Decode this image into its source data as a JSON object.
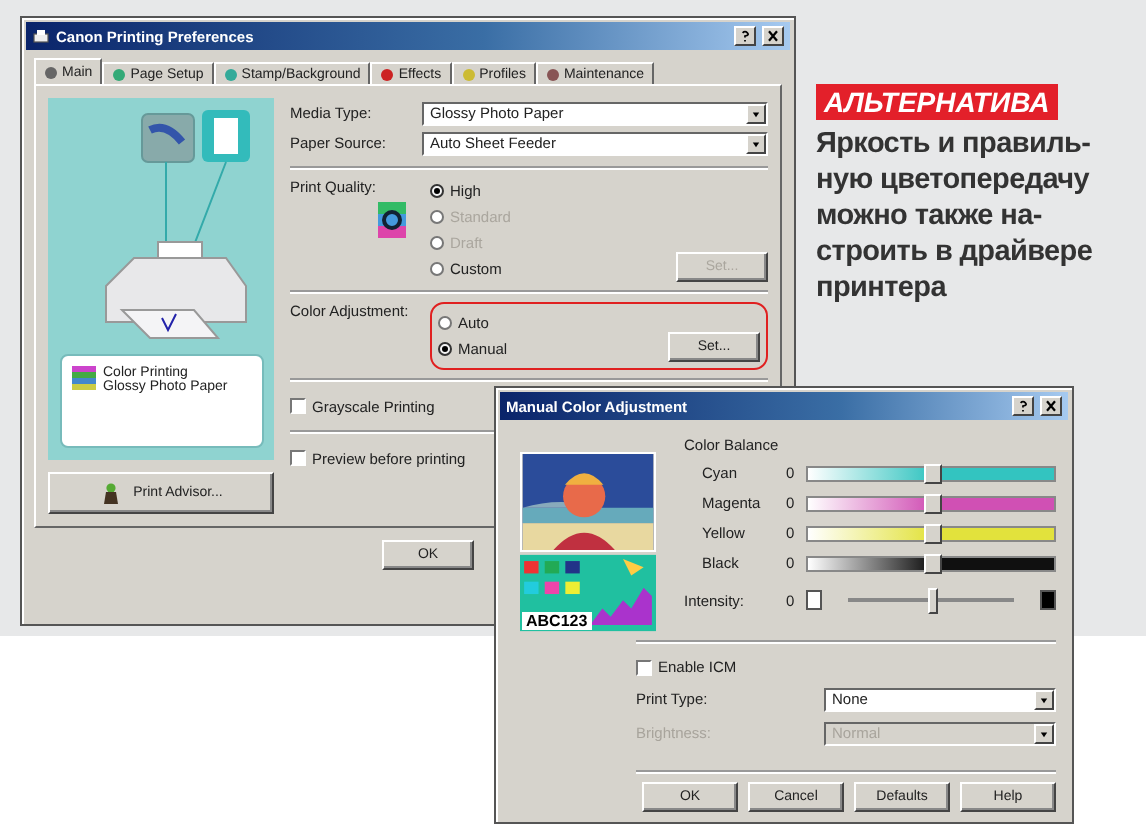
{
  "main_window": {
    "title": "Canon Printing Preferences",
    "tabs": [
      {
        "label": "Main",
        "selected": true
      },
      {
        "label": "Page Setup",
        "selected": false
      },
      {
        "label": "Stamp/Background",
        "selected": false
      },
      {
        "label": "Effects",
        "selected": false
      },
      {
        "label": "Profiles",
        "selected": false
      },
      {
        "label": "Maintenance",
        "selected": false
      }
    ],
    "preview_card": {
      "lines": [
        "Color Printing",
        "Glossy Photo Paper"
      ]
    },
    "print_advisor_button": "Print Advisor...",
    "media_type": {
      "label": "Media Type:",
      "value": "Glossy Photo Paper"
    },
    "paper_source": {
      "label": "Paper Source:",
      "value": "Auto Sheet Feeder"
    },
    "print_quality": {
      "label": "Print Quality:",
      "options": [
        {
          "label": "High",
          "selected": true,
          "disabled": false
        },
        {
          "label": "Standard",
          "selected": false,
          "disabled": true
        },
        {
          "label": "Draft",
          "selected": false,
          "disabled": true
        },
        {
          "label": "Custom",
          "selected": false,
          "disabled": false
        }
      ],
      "set_button": {
        "label": "Set...",
        "disabled": true
      }
    },
    "color_adjustment": {
      "label": "Color Adjustment:",
      "highlighted": true,
      "options": [
        {
          "label": "Auto",
          "selected": false,
          "disabled": false
        },
        {
          "label": "Manual",
          "selected": true,
          "disabled": false
        }
      ],
      "set_button": {
        "label": "Set...",
        "disabled": false
      }
    },
    "checkboxes": [
      {
        "label": "Grayscale Printing",
        "checked": false
      },
      {
        "label": "Preview before printing",
        "checked": false
      }
    ],
    "buttons": [
      "OK"
    ]
  },
  "color_dialog": {
    "title": "Manual Color Adjustment",
    "sample_text": "ABC123",
    "color_balance": {
      "label": "Color Balance",
      "channels": [
        {
          "name": "Cyan",
          "reading": "0",
          "level": 0.5,
          "color": "#33c4c0"
        },
        {
          "name": "Magenta",
          "reading": "0",
          "level": 0.5,
          "color": "#d050b4"
        },
        {
          "name": "Yellow",
          "reading": "0",
          "level": 0.5,
          "color": "#e2e23c"
        },
        {
          "name": "Black",
          "reading": "0",
          "level": 0.5,
          "color": "#101010"
        }
      ]
    },
    "intensity": {
      "label": "Intensity:",
      "reading": "0",
      "level": 0.5
    },
    "enable_icm": {
      "label": "Enable ICM",
      "checked": false
    },
    "print_type": {
      "label": "Print Type:",
      "value": "None",
      "disabled": false
    },
    "brightness": {
      "label": "Brightness:",
      "value": "Normal",
      "disabled": true
    },
    "buttons": [
      "OK",
      "Cancel",
      "Defaults",
      "Help"
    ]
  },
  "caption": {
    "tag": "АЛЬТЕРНАТИВА",
    "lines": [
      "Яркость и правиль-",
      "ную цветопередачу",
      "можно также на-",
      "строить в драйвере",
      "принтера"
    ]
  }
}
